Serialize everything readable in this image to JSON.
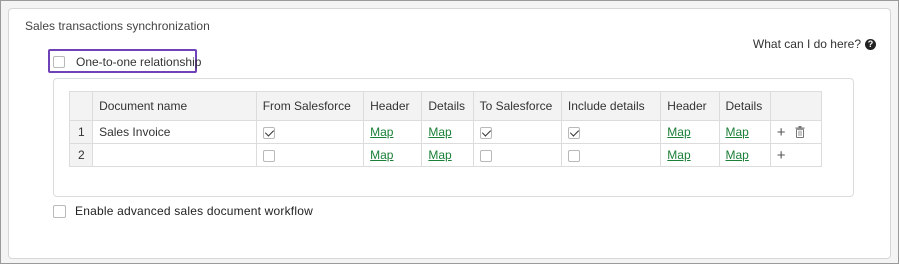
{
  "section": {
    "title": "Sales transactions synchronization",
    "help_label": "What can I do here?"
  },
  "one_to_one": {
    "label": "One-to-one relationship",
    "checked": false
  },
  "table": {
    "headers": [
      "",
      "Document name",
      "From Salesforce",
      "Header",
      "Details",
      "To Salesforce",
      "Include details",
      "Header",
      "Details",
      ""
    ],
    "rows": [
      {
        "num": "1",
        "document_name": "Sales Invoice",
        "from_salesforce": true,
        "header_from": "Map",
        "details_from": "Map",
        "to_salesforce": true,
        "include_details": true,
        "header_to": "Map",
        "details_to": "Map",
        "actions": [
          "plus-icon",
          "trash-icon"
        ]
      },
      {
        "num": "2",
        "document_name": "",
        "from_salesforce": false,
        "header_from": "Map",
        "details_from": "Map",
        "to_salesforce": false,
        "include_details": false,
        "header_to": "Map",
        "details_to": "Map",
        "actions": [
          "plus-icon"
        ]
      }
    ]
  },
  "advanced": {
    "label": "Enable advanced sales document workflow",
    "checked": false
  },
  "colors": {
    "highlight": "#6f42b8",
    "link": "#1a7f37"
  }
}
